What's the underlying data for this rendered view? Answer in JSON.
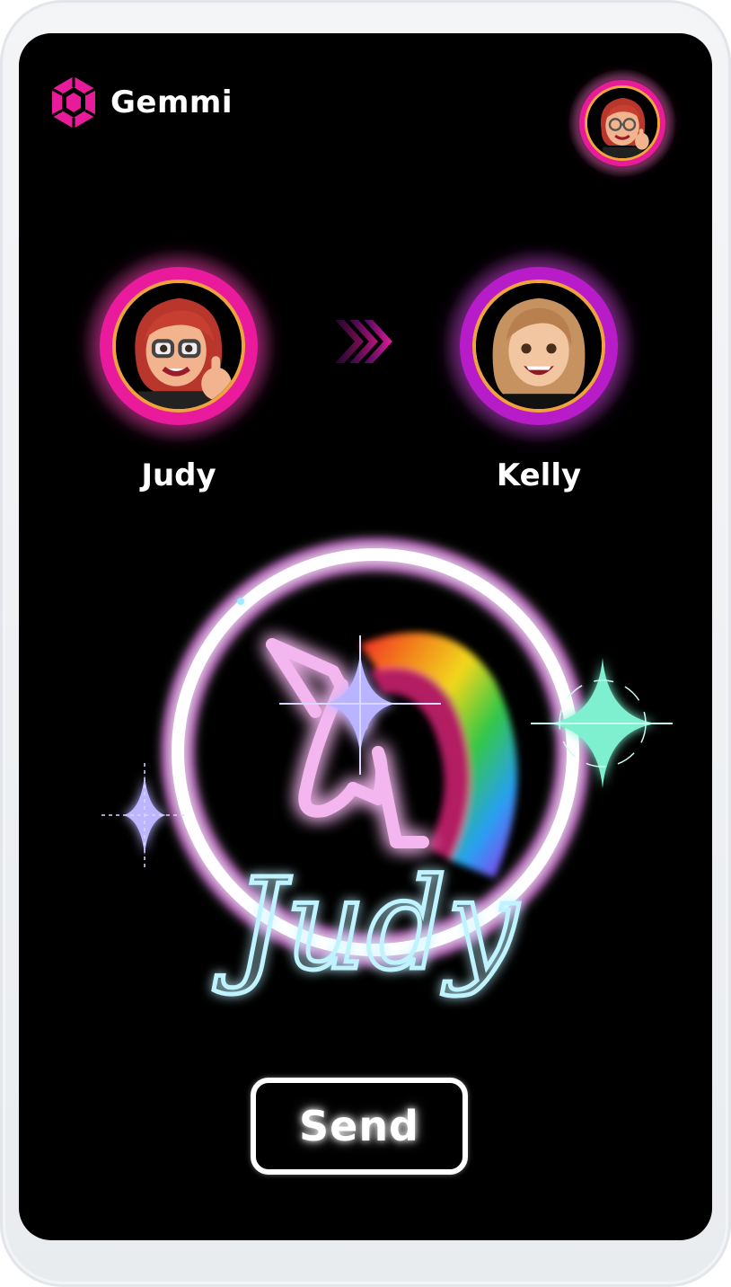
{
  "app": {
    "brand_name": "Gemmi",
    "brand_icon": "gem-hexagon-icon",
    "accent_color": "#e81b9a"
  },
  "profile": {
    "avatar": "memoji-woman-red-hair-thumbs-up"
  },
  "transfer": {
    "sender": {
      "name": "Judy",
      "avatar": "memoji-woman-red-hair-thumbs-up",
      "ring_color": "#ea1a9d"
    },
    "recipient": {
      "name": "Kelly",
      "avatar": "memoji-woman-blonde-smiling",
      "ring_color": "#b81cc8"
    },
    "arrow_icon": "triple-chevron-right-icon"
  },
  "gift": {
    "name_text": "Judy",
    "artwork": "neon-unicorn-rainbow-mane"
  },
  "actions": {
    "send_label": "Send"
  }
}
